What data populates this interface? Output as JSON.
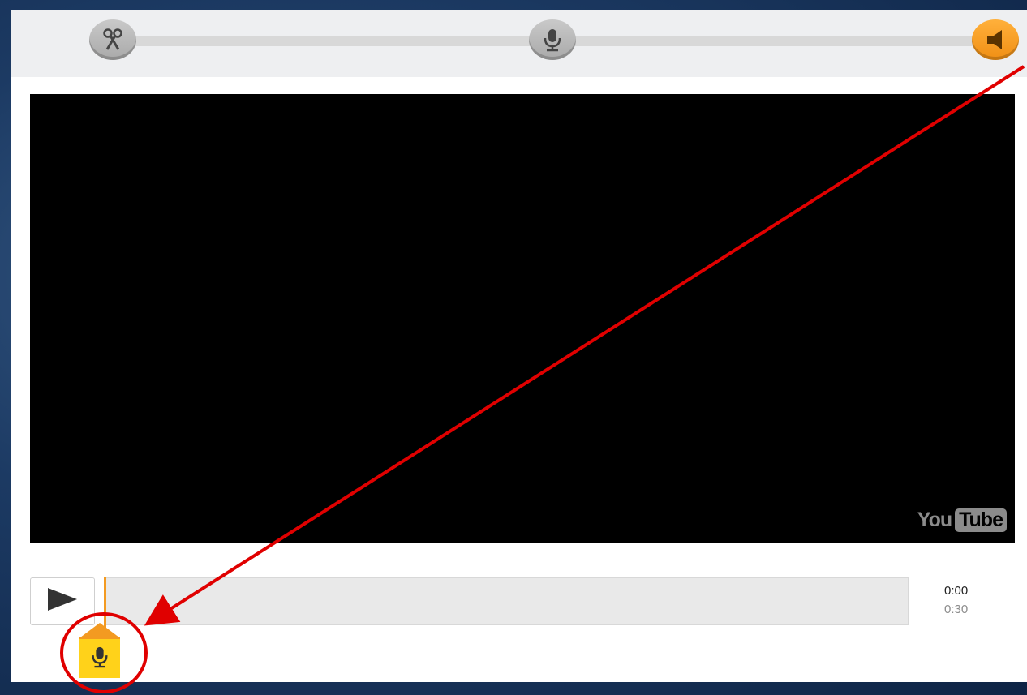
{
  "steps": [
    {
      "name": "trim",
      "icon": "scissors-icon",
      "state": "inactive"
    },
    {
      "name": "record",
      "icon": "microphone-icon",
      "state": "inactive"
    },
    {
      "name": "sound",
      "icon": "speaker-icon",
      "state": "active"
    }
  ],
  "video": {
    "logo": {
      "you": "You",
      "tube": "Tube"
    }
  },
  "player": {
    "current_time": "0:00",
    "total_time": "0:30",
    "play_icon": "play-icon",
    "marker_icon": "microphone-icon"
  },
  "colors": {
    "accent_orange": "#f39a21",
    "marker_yellow": "#ffd21a",
    "annotation_red": "#e00000",
    "step_gray": "#b5b5b5"
  }
}
